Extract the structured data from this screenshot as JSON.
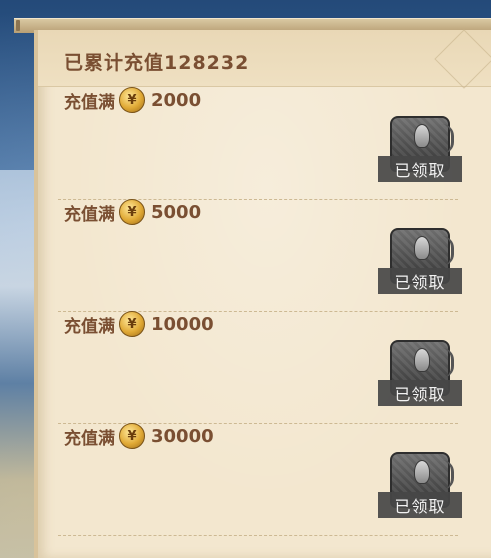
{
  "header": {
    "total_recharged": "已累计充值128232"
  },
  "tiers": [
    {
      "prefix": "充值满",
      "coin_glyph": "¥",
      "amount": "2000",
      "status": "已领取"
    },
    {
      "prefix": "充值满",
      "coin_glyph": "¥",
      "amount": "5000",
      "status": "已领取"
    },
    {
      "prefix": "充值满",
      "coin_glyph": "¥",
      "amount": "10000",
      "status": "已领取"
    },
    {
      "prefix": "充值满",
      "coin_glyph": "¥",
      "amount": "30000",
      "status": "已领取"
    }
  ],
  "icons": {
    "coin": "gold-coin-icon",
    "reward": "gray-armor-chest-icon"
  },
  "colors": {
    "text_brown": "#7a4f32",
    "paper": "#f3e7cf",
    "claimed_bg": "#464646"
  }
}
